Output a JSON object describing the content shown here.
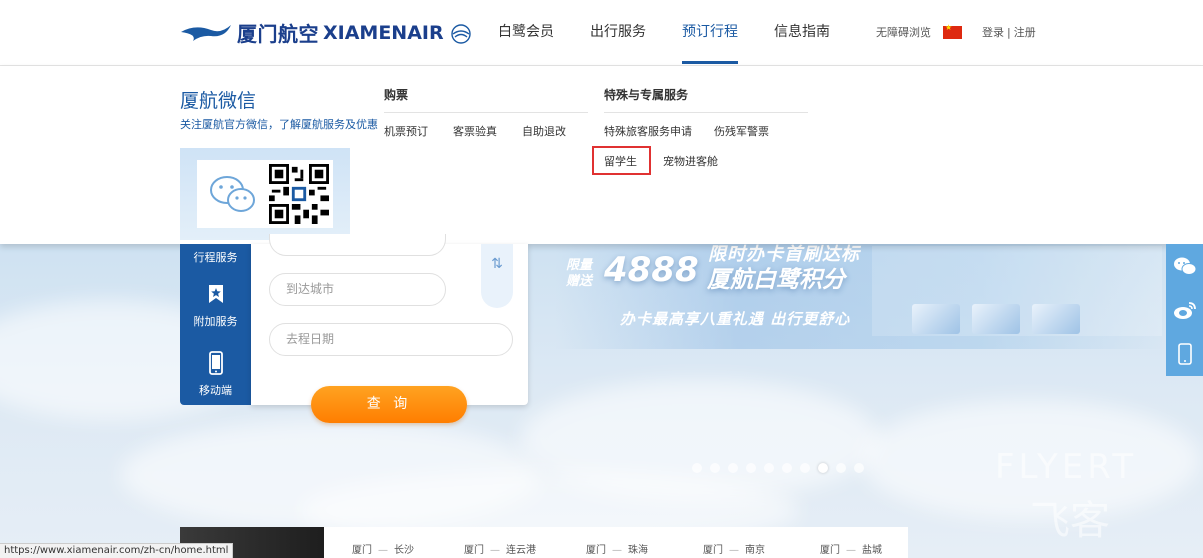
{
  "header": {
    "logo_cn": "厦门航空",
    "logo_en": "XIAMENAIR",
    "nav": [
      {
        "label": "白鹭会员",
        "active": false
      },
      {
        "label": "出行服务",
        "active": false
      },
      {
        "label": "预订行程",
        "active": true
      },
      {
        "label": "信息指南",
        "active": false
      }
    ],
    "accessibility": "无障碍浏览",
    "login": "登录",
    "separator": "|",
    "register": "注册",
    "brand_color": "#1b3f8c"
  },
  "dropdown": {
    "wechat_title": "厦航微信",
    "wechat_desc": "关注厦航官方微信，了解厦航服务及优惠",
    "col1": {
      "title": "购票",
      "links": [
        "机票预订",
        "客票验真",
        "自助退改"
      ]
    },
    "col2": {
      "title": "特殊与专属服务",
      "links": [
        "特殊旅客服务申请",
        "伤残军警票",
        "留学生",
        "宠物进客舱"
      ]
    }
  },
  "booking": {
    "side": [
      "行程服务",
      "附加服务",
      "移动端"
    ],
    "arrival_placeholder": "到达城市",
    "date_placeholder": "去程日期",
    "search_label": "查 询",
    "accent": "#ff8c0a"
  },
  "banner": {
    "headline": "限时办卡首刷达标",
    "left_small": "限量赠送",
    "big_number": "4888",
    "big_cn": "厦航白鹭积分",
    "subline": "办卡最高享八重礼遇 出行更舒心",
    "watermark_en": "FLYERT",
    "watermark_cn": "飞客",
    "dots": 10,
    "active_dot": 7
  },
  "routes": [
    {
      "from": "厦门",
      "to": "长沙"
    },
    {
      "from": "厦门",
      "to": "连云港"
    },
    {
      "from": "厦门",
      "to": "珠海"
    },
    {
      "from": "厦门",
      "to": "南京"
    },
    {
      "from": "厦门",
      "to": "盐城"
    }
  ],
  "route_sep": "—",
  "status_url": "https://www.xiamenair.com/zh-cn/home.html"
}
